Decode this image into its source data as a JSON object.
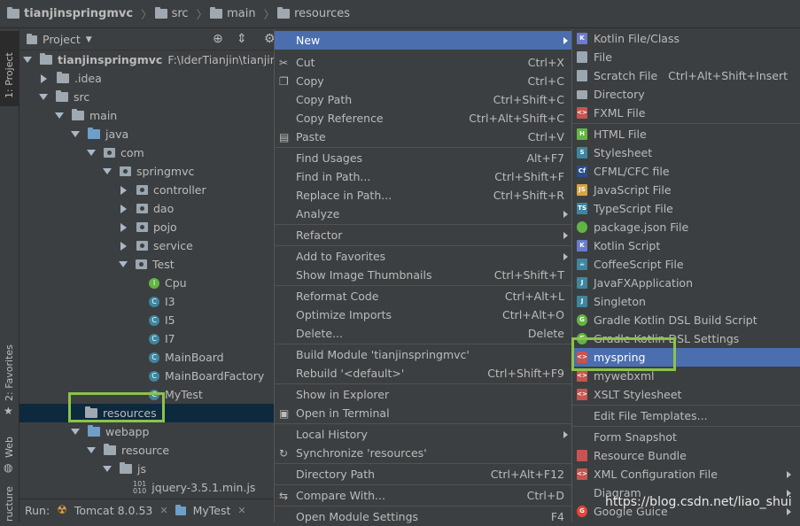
{
  "breadcrumb": {
    "project": "tianjinspringmvc",
    "src": "src",
    "main": "main",
    "resources": "resources"
  },
  "leftstrip": {
    "project_label": "1: Project",
    "favorites_label": "2: Favorites",
    "web_label": "Web",
    "structure_label": "ructure"
  },
  "project_panel": {
    "title": "Project",
    "root_name": "tianjinspringmvc",
    "root_path": "F:\\IderTianjin\\tianjinspri"
  },
  "tree": {
    "idea": ".idea",
    "src": "src",
    "main": "main",
    "java": "java",
    "com": "com",
    "springmvc": "springmvc",
    "controller": "controller",
    "dao": "dao",
    "pojo": "pojo",
    "service": "service",
    "test": "Test",
    "cpu": "Cpu",
    "i3": "I3",
    "i5": "I5",
    "i7": "I7",
    "mainboard": "MainBoard",
    "mainboardfactory": "MainBoardFactory",
    "mytest": "MyTest",
    "resources": "resources",
    "webapp": "webapp",
    "resource": "resource",
    "js": "js",
    "jquery": "jquery-3.5.1.min.js"
  },
  "runbar": {
    "label": "Run:",
    "tab1": "Tomcat 8.0.53",
    "tab2": "MyTest"
  },
  "menu": {
    "new": "New",
    "cut": "Cut",
    "cut_sc": "Ctrl+X",
    "copy": "Copy",
    "copy_sc": "Ctrl+C",
    "copy_path": "Copy Path",
    "copy_path_sc": "Ctrl+Shift+C",
    "copy_ref": "Copy Reference",
    "copy_ref_sc": "Ctrl+Alt+Shift+C",
    "paste": "Paste",
    "paste_sc": "Ctrl+V",
    "find_usages": "Find Usages",
    "find_usages_sc": "Alt+F7",
    "find_in_path": "Find in Path...",
    "find_in_path_sc": "Ctrl+Shift+F",
    "replace_in_path": "Replace in Path...",
    "replace_in_path_sc": "Ctrl+Shift+R",
    "analyze": "Analyze",
    "refactor": "Refactor",
    "add_favorites": "Add to Favorites",
    "show_thumbs": "Show Image Thumbnails",
    "show_thumbs_sc": "Ctrl+Shift+T",
    "reformat": "Reformat Code",
    "reformat_sc": "Ctrl+Alt+L",
    "optimize": "Optimize Imports",
    "optimize_sc": "Ctrl+Alt+O",
    "delete": "Delete...",
    "delete_sc": "Delete",
    "build_module": "Build Module 'tianjinspringmvc'",
    "rebuild": "Rebuild '<default>'",
    "rebuild_sc": "Ctrl+Shift+F9",
    "show_explorer": "Show in Explorer",
    "open_terminal": "Open in Terminal",
    "local_history": "Local History",
    "synchronize": "Synchronize 'resources'",
    "directory_path": "Directory Path",
    "directory_path_sc": "Ctrl+Alt+F12",
    "compare_with": "Compare With...",
    "compare_with_sc": "Ctrl+D",
    "open_module_settings": "Open Module Settings",
    "open_module_settings_sc": "F4"
  },
  "submenu": {
    "kotlin_file": "Kotlin File/Class",
    "file": "File",
    "scratch": "Scratch File",
    "scratch_sc": "Ctrl+Alt+Shift+Insert",
    "directory": "Directory",
    "fxml": "FXML File",
    "html": "HTML File",
    "stylesheet": "Stylesheet",
    "cfml": "CFML/CFC file",
    "javascript": "JavaScript File",
    "typescript": "TypeScript File",
    "packagejson": "package.json File",
    "kotlin_script": "Kotlin Script",
    "coffeescript": "CoffeeScript File",
    "javafx": "JavaFXApplication",
    "singleton": "Singleton",
    "gradle_build": "Gradle Kotlin DSL Build Script",
    "gradle_settings": "Gradle Kotlin DSL Settings",
    "myspring": "myspring",
    "mywebxml": "mywebxml",
    "xslt": "XSLT Stylesheet",
    "edit_templates": "Edit File Templates...",
    "form_snapshot": "Form Snapshot",
    "resource_bundle": "Resource Bundle",
    "xml_config": "XML Configuration File",
    "diagram": "Diagram",
    "google_guice": "Google Guice"
  },
  "watermark": "https://blog.csdn.net/liao_shui",
  "colors": {
    "background": "#3c3f41",
    "selection": "#4b6eaf",
    "highlight_box": "#8bc34a",
    "selected_row": "#0d293e"
  }
}
